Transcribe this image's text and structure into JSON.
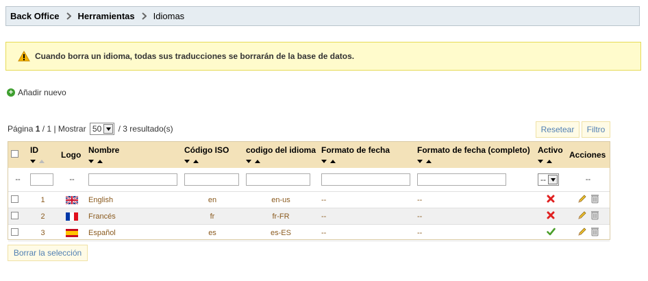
{
  "breadcrumb": [
    "Back Office",
    "Herramientas",
    "Idiomas"
  ],
  "warning": "Cuando borra un idioma, todas sus traducciones se borrarán de la base de datos.",
  "add_new": "Añadir nuevo",
  "pager": {
    "page_label": "Página",
    "page_current": "1",
    "page_total": "/ 1",
    "show_label": "| Mostrar",
    "per_page": "50",
    "results": "/ 3 resultado(s)"
  },
  "buttons": {
    "reset": "Resetear",
    "filter": "Filtro",
    "delete_selected": "Borrar la selección"
  },
  "columns": [
    "ID",
    "Logo",
    "Nombre",
    "Código ISO",
    "codigo del idioma",
    "Formato de fecha",
    "Formato de fecha (completo)",
    "Activo",
    "Acciones"
  ],
  "filter": {
    "placeholder_dash": "--",
    "active_select": "--"
  },
  "rows": [
    {
      "id": "1",
      "flag": "uk",
      "name": "English",
      "iso": "en",
      "lang_code": "en-us",
      "date_format": "--",
      "date_format_full": "--",
      "active": false
    },
    {
      "id": "2",
      "flag": "fr",
      "name": "Francés",
      "iso": "fr",
      "lang_code": "fr-FR",
      "date_format": "--",
      "date_format_full": "--",
      "active": false
    },
    {
      "id": "3",
      "flag": "es",
      "name": "Español",
      "iso": "es",
      "lang_code": "es-ES",
      "date_format": "--",
      "date_format_full": "--",
      "active": true
    }
  ],
  "colors": {
    "link": "#4f7fb3",
    "header_bg": "#f3e2b9",
    "warning_bg": "#fffbcc",
    "active_green": "#4a9e2a",
    "inactive_red": "#e02020"
  }
}
